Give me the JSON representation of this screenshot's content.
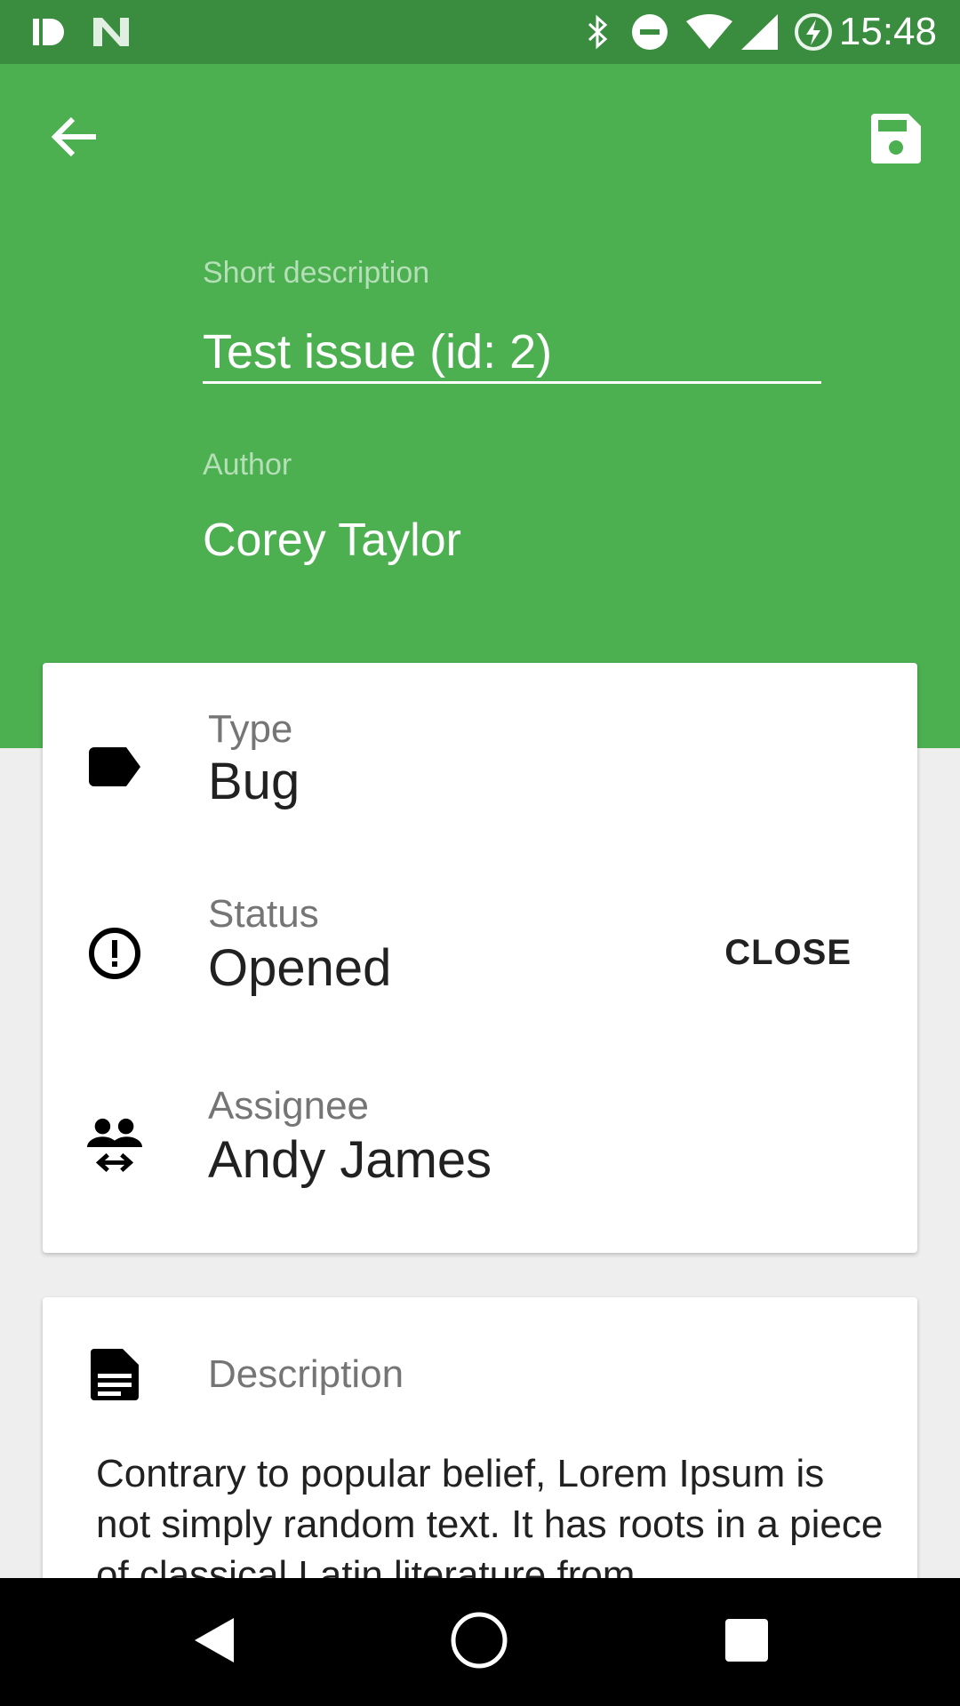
{
  "status_bar": {
    "time": "15:48",
    "left_icons": [
      "id-icon",
      "n-icon"
    ],
    "right_icons": [
      "bluetooth-icon",
      "do-not-disturb-icon",
      "wifi-icon",
      "signal-icon",
      "battery-charging-icon"
    ]
  },
  "header": {
    "back_icon": "arrow-back-icon",
    "save_icon": "save-icon",
    "short_description": {
      "label": "Short description",
      "value": "Test issue (id: 2)"
    },
    "author": {
      "label": "Author",
      "value": "Corey Taylor"
    }
  },
  "details_card": {
    "type": {
      "icon": "label-icon",
      "label": "Type",
      "value": "Bug"
    },
    "status": {
      "icon": "alert-circle-icon",
      "label": "Status",
      "value": "Opened",
      "action_label": "CLOSE"
    },
    "assignee": {
      "icon": "people-swap-icon",
      "label": "Assignee",
      "value": "Andy James"
    }
  },
  "description_card": {
    "icon": "document-icon",
    "label": "Description",
    "text": "Contrary to popular belief, Lorem Ipsum is not simply random text. It has roots in a piece of classical Latin literature from"
  },
  "nav_bar": {
    "icons": [
      "nav-back-icon",
      "nav-home-icon",
      "nav-recents-icon"
    ]
  },
  "colors": {
    "primary": "#4caf50",
    "primary_dark": "#3a8d3f",
    "background": "#eeeeee"
  }
}
